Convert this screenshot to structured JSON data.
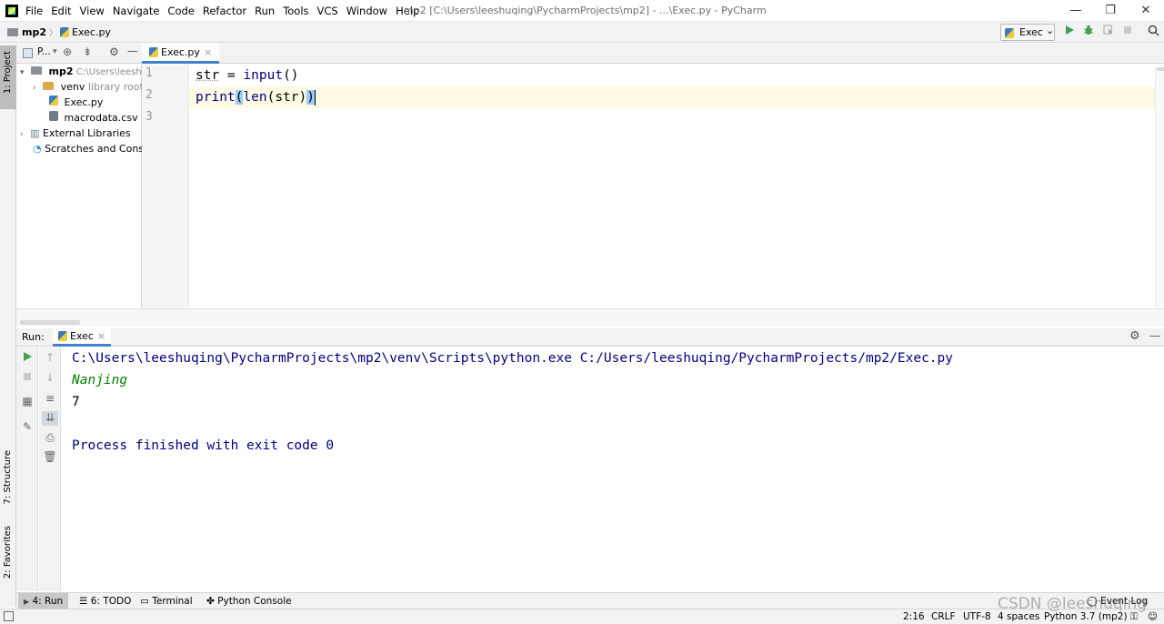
{
  "window": {
    "menu": [
      "File",
      "Edit",
      "View",
      "Navigate",
      "Code",
      "Refactor",
      "Run",
      "Tools",
      "VCS",
      "Window",
      "Help"
    ],
    "title": "mp2 [C:\\Users\\leeshuqing\\PycharmProjects\\mp2] - ...\\Exec.py - PyCharm",
    "minimize": "—",
    "restore": "❐",
    "close": "✕"
  },
  "navbar": {
    "project": "mp2",
    "separator": "〉",
    "file": "Exec.py",
    "run_config": "Exec",
    "run_config_arrow": "⌄",
    "icons": [
      "run-icon",
      "debug-icon",
      "coverage-icon",
      "stop-icon",
      "search-icon"
    ]
  },
  "left_strip": {
    "project": "1: Project",
    "structure": "7: Structure",
    "favorites": "2: Favorites"
  },
  "project_panel": {
    "selector": "P...",
    "tree": {
      "root_name": "mp2",
      "root_path": "C:\\Users\\leeshuq",
      "venv": "venv",
      "venv_note": "library root",
      "exec_file": "Exec.py",
      "csv_file": "macrodata.csv",
      "external": "External Libraries",
      "scratches": "Scratches and Consol"
    }
  },
  "editor": {
    "tab_label": "Exec.py",
    "tab_close": "×",
    "line_numbers": [
      "1",
      "2",
      "3"
    ],
    "line1": {
      "var": "str",
      "op": " = ",
      "func": "input",
      "args": "()"
    },
    "line2": {
      "func": "print",
      "open1": "(",
      "inner_func": "len",
      "open2": "(",
      "arg": "str",
      "close2": ")",
      "close1": ")"
    }
  },
  "run_window": {
    "title": "Run:",
    "tab": "Exec",
    "tab_close": "×",
    "console": {
      "command": "C:\\Users\\leeshuqing\\PycharmProjects\\mp2\\venv\\Scripts\\python.exe C:/Users/leeshuqing/PycharmProjects/mp2/Exec.py",
      "input": "Nanjing",
      "output": "7",
      "finished": "Process finished with exit code 0"
    },
    "colors": {
      "command": "#000080",
      "input": "#008000",
      "output": "#000000"
    }
  },
  "bottom_tools": {
    "run": "4: Run",
    "todo": "6: TODO",
    "terminal": "Terminal",
    "python_console": "Python Console",
    "event_log": "Event Log"
  },
  "statusbar": {
    "position": "2:16",
    "line_sep": "CRLF",
    "encoding": "UTF-8",
    "indent": "4 spaces",
    "interpreter": "Python 3.7 (mp2)"
  },
  "watermark": "CSDN @leeshuqing"
}
